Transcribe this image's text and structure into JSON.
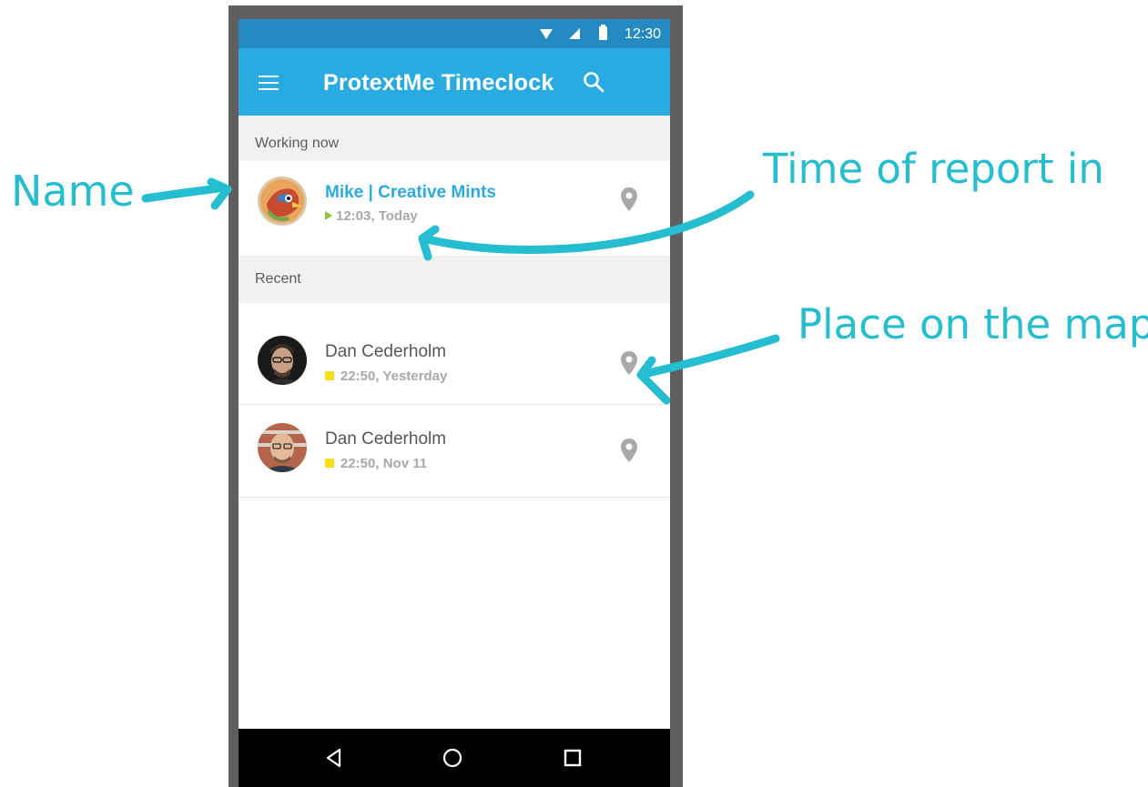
{
  "status_bar": {
    "time": "12:30"
  },
  "app_bar": {
    "title": "ProtextMe Timeclock"
  },
  "sections": {
    "working_now": "Working now",
    "recent": "Recent"
  },
  "working_now": [
    {
      "name": "Mike | Creative Mints",
      "time": "12:03, Today",
      "status_color": "#8dc63f"
    }
  ],
  "recent": [
    {
      "name": "Dan Cederholm",
      "time": "22:50, Yesterday",
      "status_color": "#f4e11b"
    },
    {
      "name": "Dan Cederholm",
      "time": "22:50, Nov 11",
      "status_color": "#f4e11b"
    }
  ],
  "annotations": {
    "name": "Name",
    "time_of_report": "Time of report in",
    "place_on_map": "Place on the map"
  },
  "colors": {
    "primary": "#29abe2",
    "status_bar": "#2589c2",
    "annotation": "#25bdd0",
    "active_name": "#29abe2"
  },
  "icons": [
    "menu-icon",
    "search-icon",
    "map-pin-icon",
    "play-icon",
    "stop-icon",
    "back-icon",
    "home-icon",
    "recents-icon",
    "wifi-icon",
    "signal-icon",
    "battery-icon"
  ]
}
